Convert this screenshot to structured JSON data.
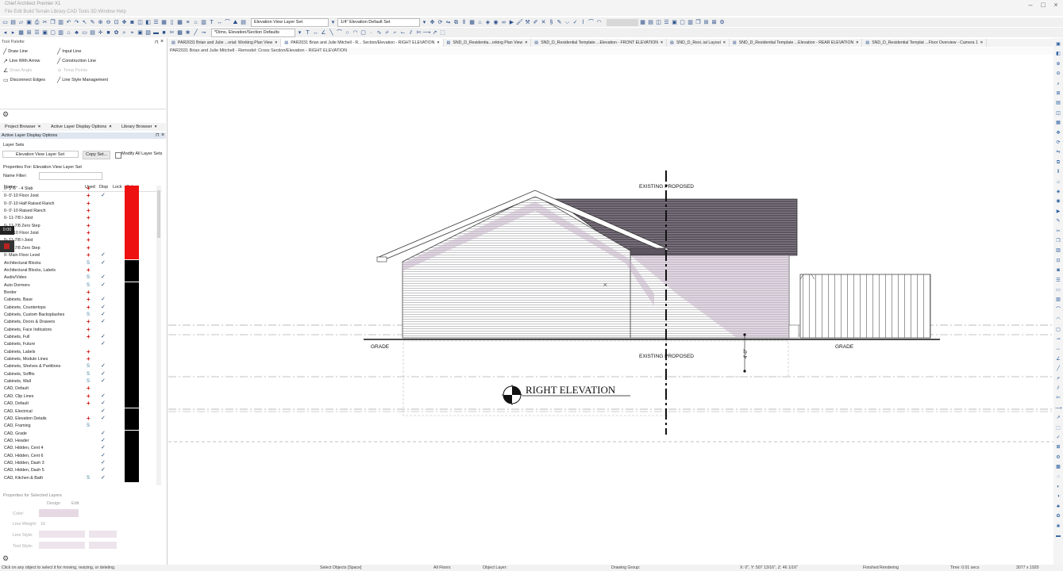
{
  "app": {
    "title": "Chief Architect Premier X1",
    "menu": "File  Edit  Build  Terrain  Library  CAD  Tools  3D  Window  Help"
  },
  "toolbar": {
    "layer_set_dropdown": "Elevation View Layer Set",
    "scale_dropdown": "1/4\" Elevation Default Set",
    "defaults_dropdown": "*Dims, Elevation/Section Defaults"
  },
  "colors": {
    "accent": "#2a4f8a",
    "used_red": "#d01010",
    "layer_red": "#ee1111",
    "layer_black": "#000000",
    "roof": "#5d5560",
    "wall_shadow": "#c5b3c6"
  },
  "palette": {
    "title": "Tool Palette",
    "items": [
      {
        "label": "Draw Line",
        "icon": "draw-line-icon",
        "enabled": true
      },
      {
        "label": "Input Line",
        "icon": "input-line-icon",
        "enabled": true
      },
      {
        "label": "Line With Arrow",
        "icon": "line-arrow-icon",
        "enabled": true
      },
      {
        "label": "Construction Line",
        "icon": "construction-line-icon",
        "enabled": true
      },
      {
        "label": "Draw Angle",
        "icon": "angle-icon",
        "enabled": false
      },
      {
        "label": "Temp Points",
        "icon": "temp-points-icon",
        "enabled": false
      },
      {
        "label": "Disconnect Edges",
        "icon": "disconnect-edges-icon",
        "enabled": true
      },
      {
        "label": "Line Style Management",
        "icon": "line-style-icon",
        "enabled": true
      }
    ]
  },
  "panel_tabs": [
    "Project Browser",
    "Active Layer Display Options",
    "Library Browser"
  ],
  "layer_panel": {
    "title": "Active Layer Display Options",
    "layer_sets_label": "Layer Sets",
    "current_set": "Elevation View Layer Set",
    "copy_set_label": "Copy Set...",
    "modify_all_label": "Modify All Layer Sets",
    "properties_label": "Properties For: Elevation View Layer Set",
    "name_filter_label": "Name Filter:",
    "columns": {
      "name": "Name",
      "used": "Used",
      "disp": "Disp",
      "lock": "Lock",
      "color": "Color"
    },
    "timer_badge": "0:00",
    "rows": [
      {
        "name": "0- 3'-6\" - 4 Slab",
        "used": "+",
        "disp": "",
        "color": "#ee1111"
      },
      {
        "name": "0- 0'-10 Floor Joist",
        "used": "+",
        "disp": "✓",
        "color": "#ee1111"
      },
      {
        "name": "0- 0'-10 Half Raised Ranch",
        "used": "+",
        "disp": "",
        "color": "#ee1111"
      },
      {
        "name": "0- 0'-10 Raised Ranch",
        "used": "+",
        "disp": "",
        "color": "#ee1111"
      },
      {
        "name": "0- 11-7/8 I-Joist",
        "used": "+",
        "disp": "",
        "color": "#ee1111"
      },
      {
        "name": "0- 11-7/8 Zero Step",
        "used": "+",
        "disp": "",
        "color": "#ee1111"
      },
      {
        "name": "0- 0'-10 Floor Joist",
        "used": "+",
        "disp": "",
        "color": "#ee1111"
      },
      {
        "name": "0- 11-7/8 I-Joist",
        "used": "+",
        "disp": "",
        "color": "#ee1111"
      },
      {
        "name": "0- 11-7/8 Zero Step",
        "used": "+",
        "disp": "",
        "color": "#ee1111"
      },
      {
        "name": "0- Main Floor Level",
        "used": "+",
        "disp": "✓",
        "color": "#ee1111"
      },
      {
        "name": "Architectural Blocks",
        "used": "S",
        "disp": "✓",
        "color": "#000000"
      },
      {
        "name": "Architectural Blocks, Labels",
        "used": "+",
        "disp": "",
        "color": "#000000"
      },
      {
        "name": "Audio/Video",
        "used": "S",
        "disp": "✓",
        "color": "#000000"
      },
      {
        "name": "Auto Dormers",
        "used": "S",
        "disp": "✓",
        "color": "#000000"
      },
      {
        "name": "Border",
        "used": "+",
        "disp": "",
        "color": "#000000"
      },
      {
        "name": "Cabinets, Base",
        "used": "+",
        "disp": "✓",
        "color": "#000000"
      },
      {
        "name": "Cabinets, Countertops",
        "used": "+",
        "disp": "✓",
        "color": "#000000"
      },
      {
        "name": "Cabinets, Custom Backsplashes",
        "used": "S",
        "disp": "✓",
        "color": "#000000"
      },
      {
        "name": "Cabinets, Doors & Drawers",
        "used": "+",
        "disp": "✓",
        "color": "#000000"
      },
      {
        "name": "Cabinets, Face Indicators",
        "used": "+",
        "disp": "",
        "color": "#000000"
      },
      {
        "name": "Cabinets, Full",
        "used": "+",
        "disp": "✓",
        "color": "#000000"
      },
      {
        "name": "Cabinets, Future",
        "used": "",
        "disp": "✓",
        "color": "#000000"
      },
      {
        "name": "Cabinets, Labels",
        "used": "+",
        "disp": "",
        "color": "#000000"
      },
      {
        "name": "Cabinets, Module Lines",
        "used": "+",
        "disp": "",
        "color": "#000000"
      },
      {
        "name": "Cabinets, Shelves & Partitions",
        "used": "S",
        "disp": "✓",
        "color": "#000000"
      },
      {
        "name": "Cabinets, Soffits",
        "used": "S",
        "disp": "✓",
        "color": "#000000"
      },
      {
        "name": "Cabinets, Wall",
        "used": "S",
        "disp": "✓",
        "color": "#000000"
      },
      {
        "name": "CAD, Default",
        "used": "+",
        "disp": "",
        "color": "#000000"
      },
      {
        "name": "CAD, Clip Lines",
        "used": "+",
        "disp": "✓",
        "color": "#000000"
      },
      {
        "name": "CAD, Default",
        "used": "+",
        "disp": "✓",
        "color": "#000000"
      },
      {
        "name": "CAD, Electrical",
        "used": "",
        "disp": "✓",
        "color": "#000000"
      },
      {
        "name": "CAD, Elevation Details",
        "used": "+",
        "disp": "✓",
        "color": "#000000"
      },
      {
        "name": "CAD, Framing",
        "used": "S",
        "disp": "",
        "color": "#000000"
      },
      {
        "name": "CAD, Grade",
        "used": "",
        "disp": "✓",
        "color": "#000000"
      },
      {
        "name": "CAD, Header",
        "used": "",
        "disp": "✓",
        "color": "#000000"
      },
      {
        "name": "CAD, Hidden, Cent 4",
        "used": "",
        "disp": "✓",
        "color": "#000000"
      },
      {
        "name": "CAD, Hidden, Cent 6",
        "used": "",
        "disp": "✓",
        "color": "#000000"
      },
      {
        "name": "CAD, Hidden, Dash 3",
        "used": "",
        "disp": "✓",
        "color": "#000000"
      },
      {
        "name": "CAD, Hidden, Dash 5",
        "used": "",
        "disp": "✓",
        "color": "#000000"
      },
      {
        "name": "CAD, Kitchen & Bath",
        "used": "S",
        "disp": "✓",
        "color": "#000000"
      }
    ]
  },
  "properties": {
    "title": "Properties for Selected Layers",
    "design_label": "Design",
    "edit_label": "Edit",
    "rows": [
      "Color:",
      "Line Weight:",
      "Line Style:",
      "Text Style:"
    ],
    "line_weight": "16"
  },
  "view_tabs": [
    "PAR2031 Brian and Julie ...orial: Working Plan View",
    "PAR2031 Brian and Julie Mitchell - R... Section/Elevation - RIGHT ELEVATION",
    "SND_D_Residentia...orking Plan View",
    "SND_D_Residential Template ...Elevation - FRONT ELEVATION",
    "SND_D_Resi..ial Layout",
    "SND_D_Residential Template ...Elevation - REAR ELEVATION",
    "SND_D_Residential Templat ...Floor Overview - Camera 1"
  ],
  "view_title": "PAR2031 Brian and Julie Mitchell - Remodel: Cross Section/Elevation - RIGHT ELEVATION",
  "drawing": {
    "existing_proposed_top": "EXISTING  PROPOSED",
    "existing_proposed_bottom": "EXISTING  PROPOSED",
    "grade_left": "GRADE",
    "grade_right": "GRADE",
    "elevation_label": "RIGHT ELEVATION",
    "dimension": "4'-0\""
  },
  "status": {
    "hint": "Click on any object to select it for moving, resizing, or deleting.",
    "mode": "Select Objects [Space]",
    "floor": "All Floors",
    "object_layer": "Object Layer:",
    "drawing_group": "Drawing Group:",
    "coords": "X: 0\", Y: 507 13/16\", Z: 46 1/16\"",
    "render": "Finished Rendering",
    "time": "Time: 0.01 secs",
    "resolution": "3077 x 1920"
  }
}
